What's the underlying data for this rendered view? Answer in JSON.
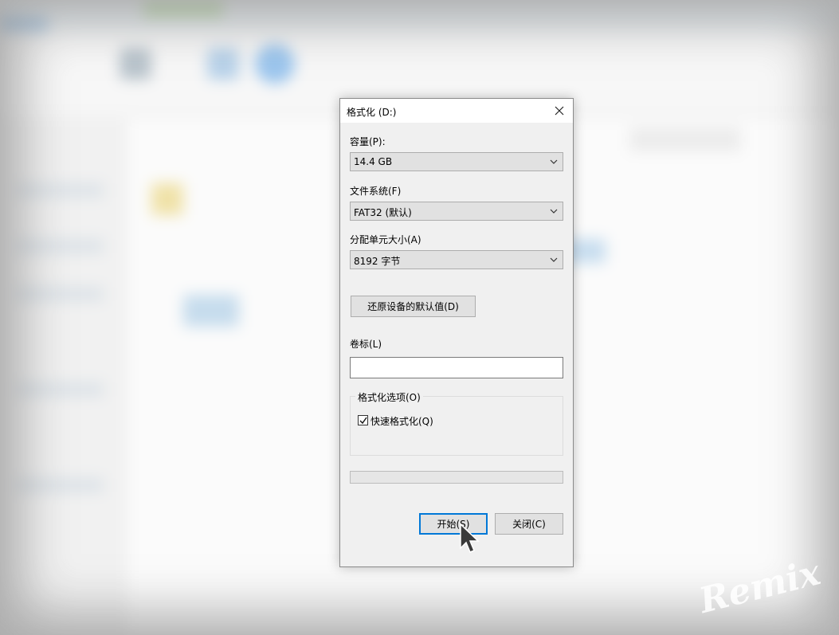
{
  "dialog": {
    "title": "格式化 (D:)",
    "close_icon": "close-icon",
    "capacity": {
      "label": "容量(P):",
      "value": "14.4 GB"
    },
    "filesystem": {
      "label": "文件系统(F)",
      "value": "FAT32 (默认)"
    },
    "allocation": {
      "label": "分配单元大小(A)",
      "value": "8192 字节"
    },
    "restore_defaults_label": "还原设备的默认值(D)",
    "volume": {
      "label": "卷标(L)",
      "value": ""
    },
    "options": {
      "group_label": "格式化选项(O)",
      "quick_format_label": "快速格式化(Q)",
      "quick_format_checked": true
    },
    "progress": 0,
    "start_label": "开始(S)",
    "close_label": "关闭(C)"
  },
  "watermark": "Remix",
  "colors": {
    "accent": "#0078d7",
    "dialog_bg": "#f0f0f0"
  }
}
